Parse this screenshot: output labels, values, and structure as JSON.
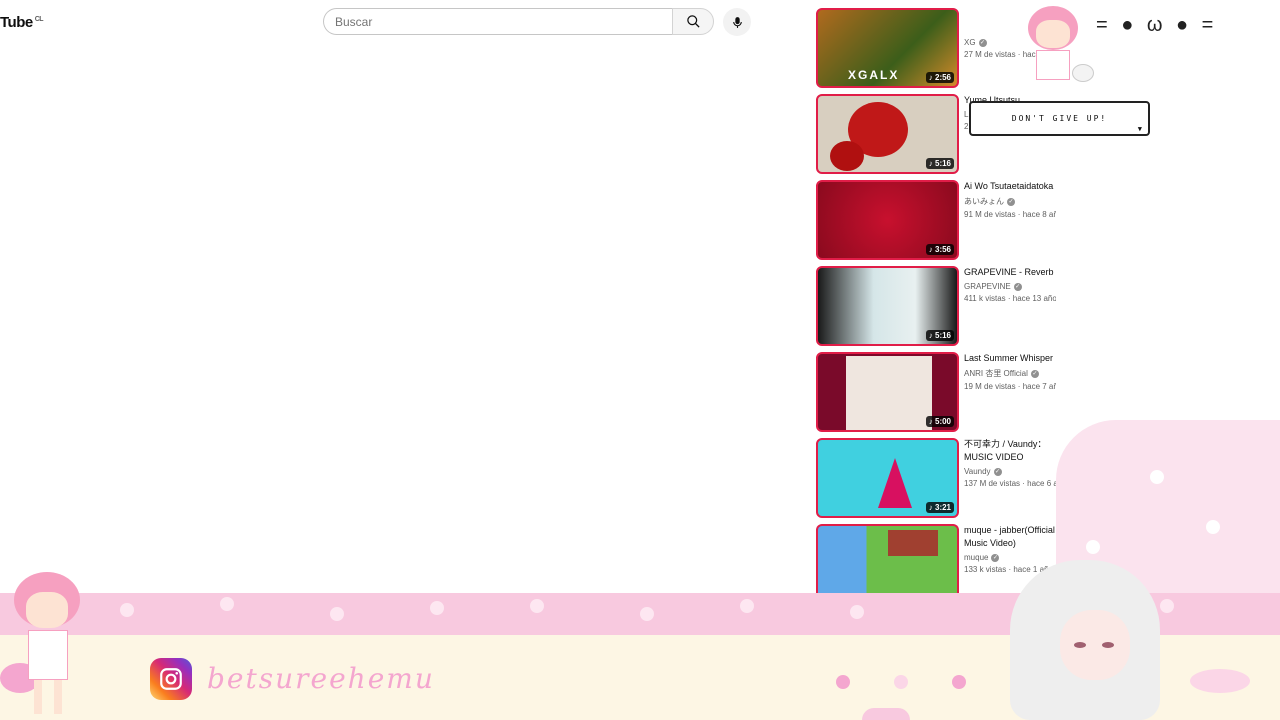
{
  "header": {
    "logo_text": "Tube",
    "logo_sup": "CL",
    "search_placeholder": "Buscar",
    "search_icon": "search-icon",
    "mic_icon": "mic-icon"
  },
  "videos": [
    {
      "title": "XGALX",
      "channel": "XG",
      "stats": "27 M de vistas · hace",
      "duration": "2:56",
      "thumb_color": "#b06a1e",
      "thumb_color2": "#3c5e1a"
    },
    {
      "title": "Yume Utsutsu",
      "channel": "L",
      "stats": "2",
      "duration": "5:16",
      "thumb_color": "#d8cfc0",
      "thumb_color2": "#c01818"
    },
    {
      "title": "Ai Wo Tsutaetaidatoka",
      "channel": "あいみょん",
      "stats": "91 M de vistas · hace 8 añ",
      "duration": "3:56",
      "thumb_color": "#c8102e",
      "thumb_color2": "#8a0a1e"
    },
    {
      "title": "GRAPEVINE - Reverb",
      "channel": "GRAPEVINE",
      "stats": "411 k vistas · hace 13 año",
      "duration": "5:16",
      "thumb_color": "#1a1a1a",
      "thumb_color2": "#d5e6e8"
    },
    {
      "title": "Last Summer Whisper",
      "channel": "ANRI 杏里 Official",
      "stats": "19 M de vistas · hace 7 añ",
      "duration": "5:00",
      "thumb_color": "#7a0a2a",
      "thumb_color2": "#efe6df"
    },
    {
      "title": "不可幸力 / Vaundy：MUSIC VIDEO",
      "channel": "Vaundy",
      "stats": "137 M de vistas · hace 6 a",
      "duration": "3:21",
      "thumb_color": "#40d0e0",
      "thumb_color2": "#d81060"
    },
    {
      "title": "muque - jabber(Official Music Video)",
      "channel": "muque",
      "stats": "133 k vistas · hace 1 año",
      "duration": "",
      "thumb_color": "#5fa8e8",
      "thumb_color2": "#6cbe4a"
    }
  ],
  "overlay": {
    "speech_bubble": "DON'T GIVE UP!",
    "kaomoji": "= ● ω ● =",
    "instagram_handle": "betsureehemu",
    "instagram_icon": "instagram-icon",
    "accent_pink": "#f8c9df",
    "cream": "#fdf6e4"
  }
}
